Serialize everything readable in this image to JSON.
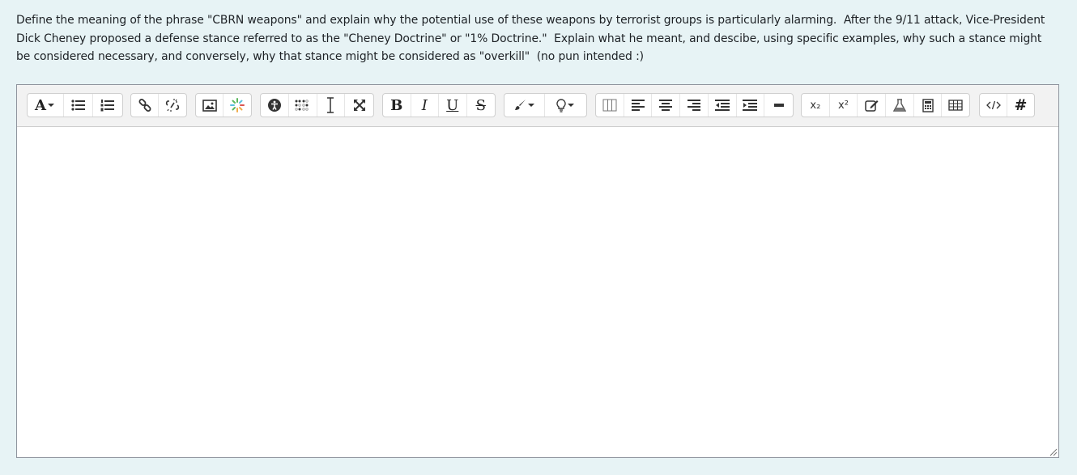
{
  "question": {
    "text": "Define the meaning of the phrase \"CBRN weapons\" and explain why the potential use of these weapons by terrorist groups is particularly alarming.  After the 9/11 attack, Vice-President Dick Cheney proposed a defense stance referred to as the \"Cheney Doctrine\" or \"1% Doctrine.\"  Explain what he meant, and descibe, using specific examples, why such a stance might be considered necessary, and conversely, why that stance might be considered as \"overkill\"  (no pun intended :)"
  },
  "toolbar": {
    "font_button_glyph": "A",
    "bold_glyph": "B",
    "italic_glyph": "I",
    "underline_glyph": "U",
    "strike_glyph": "S",
    "subscript_label": "x₂",
    "superscript_label": "x²",
    "hash_glyph": "#"
  },
  "editor": {
    "content": ""
  },
  "colors": {
    "page_bg": "#e7f3f5",
    "toolbar_bg": "#f2f2f2",
    "icon": "#333333",
    "accent_green": "#5bb85d"
  }
}
